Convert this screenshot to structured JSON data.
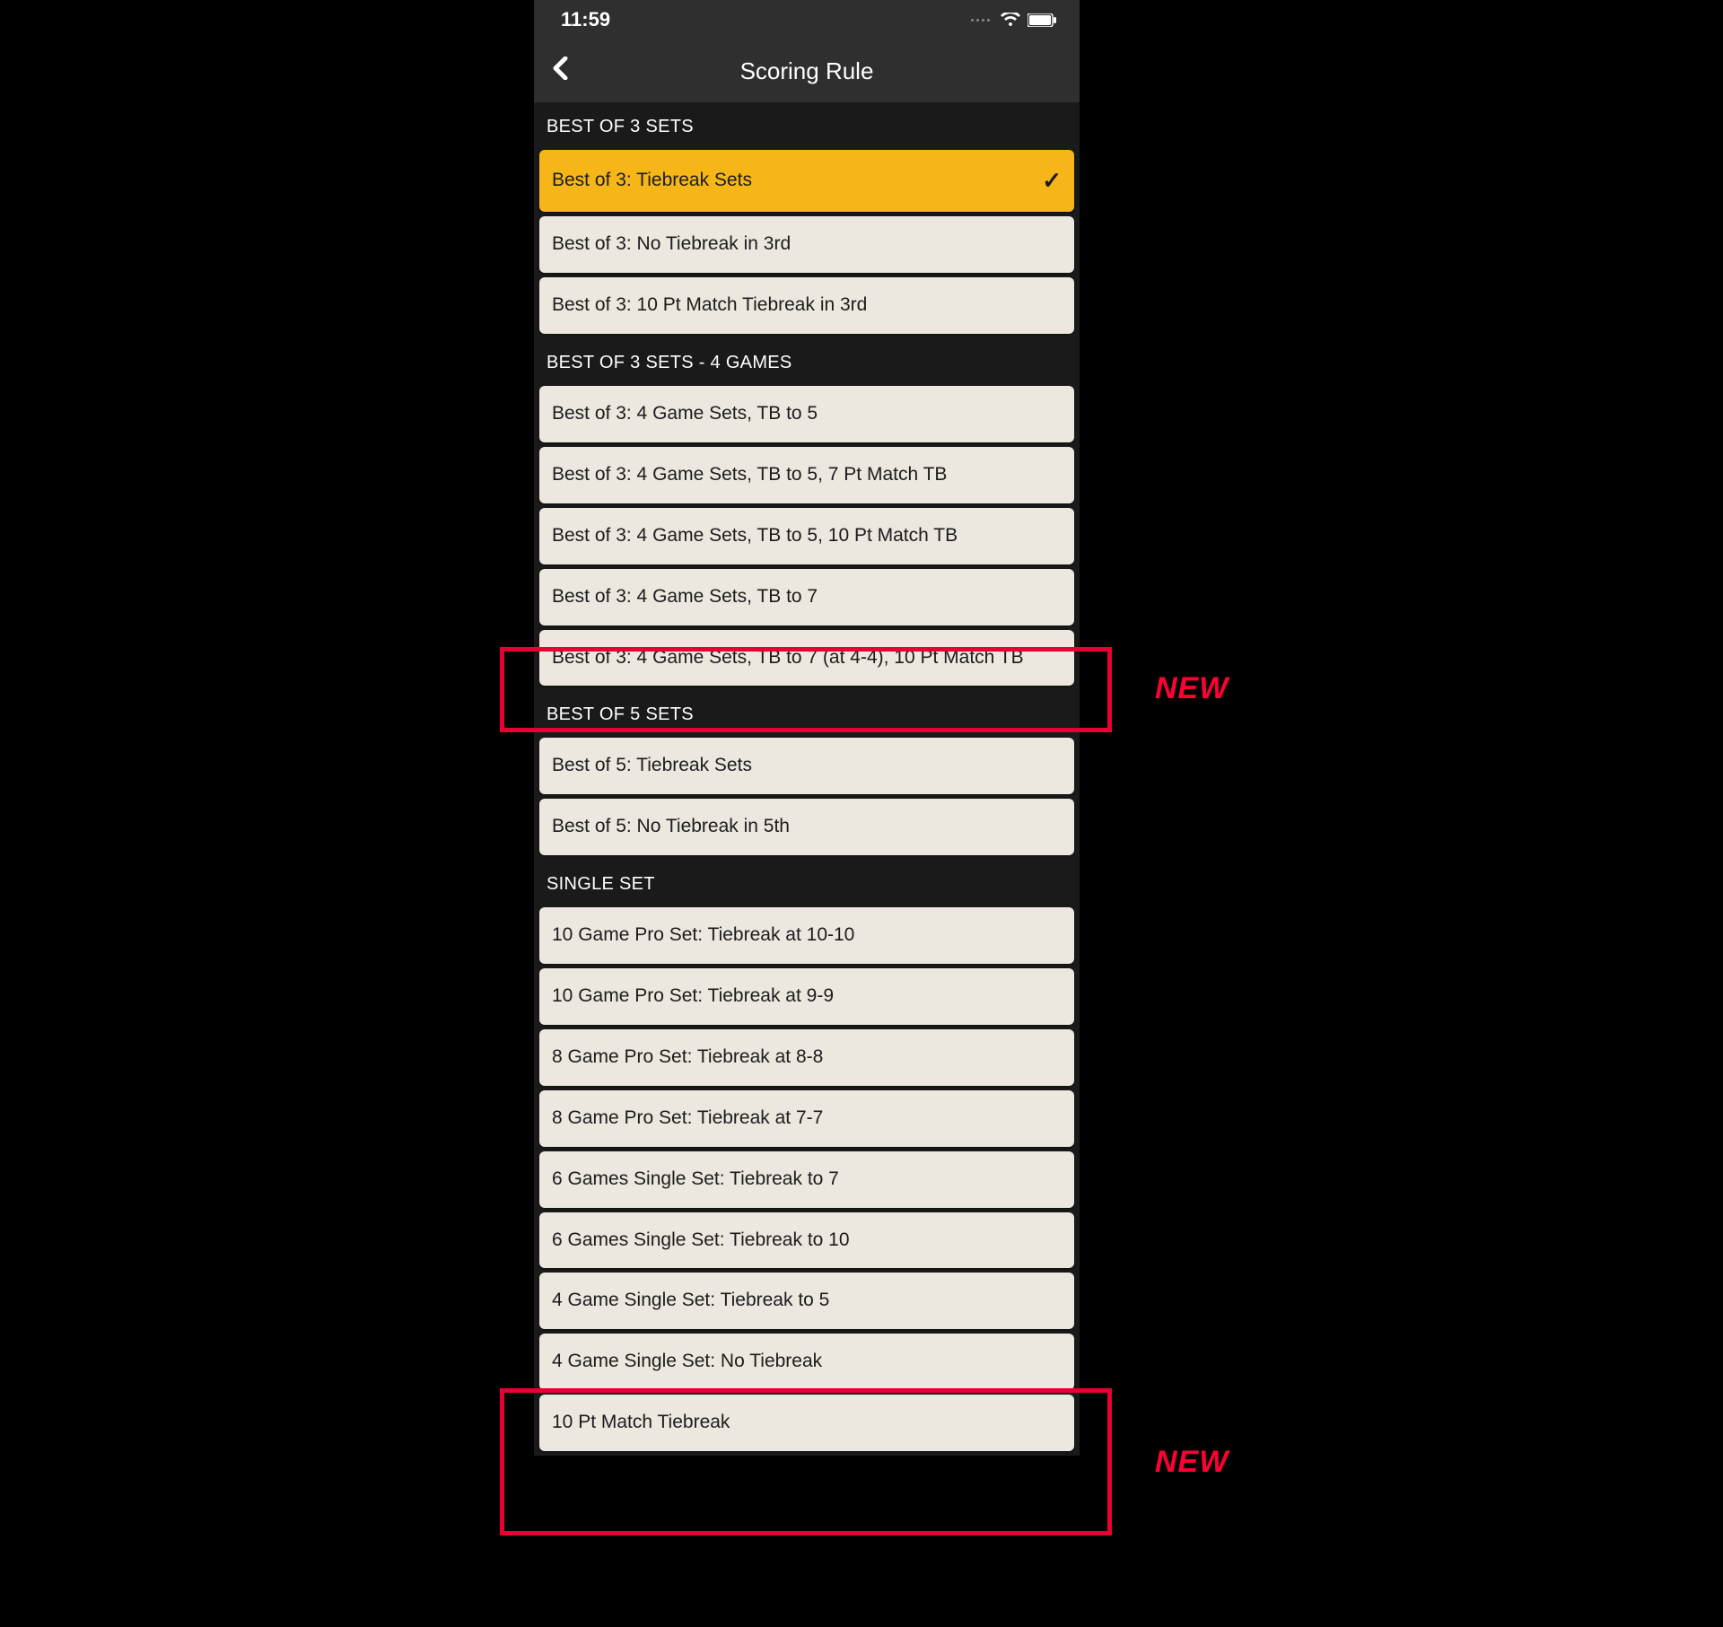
{
  "status": {
    "time": "11:59"
  },
  "nav": {
    "title": "Scoring Rule"
  },
  "sections": [
    {
      "title": "BEST OF 3 SETS",
      "items": [
        {
          "label": "Best of 3: Tiebreak Sets",
          "selected": true
        },
        {
          "label": "Best of 3: No Tiebreak in 3rd"
        },
        {
          "label": "Best of 3: 10 Pt Match Tiebreak in 3rd"
        }
      ]
    },
    {
      "title": "BEST OF 3 SETS - 4 GAMES",
      "items": [
        {
          "label": "Best of 3: 4 Game Sets, TB to 5"
        },
        {
          "label": "Best of 3: 4 Game Sets, TB to 5, 7 Pt Match TB"
        },
        {
          "label": "Best of 3: 4 Game Sets, TB to 5, 10 Pt Match TB"
        },
        {
          "label": "Best of 3: 4 Game Sets, TB to 7"
        },
        {
          "label": "Best of 3: 4 Game Sets, TB to 7 (at 4-4), 10 Pt Match TB"
        }
      ]
    },
    {
      "title": "BEST OF 5 SETS",
      "items": [
        {
          "label": "Best of 5: Tiebreak Sets"
        },
        {
          "label": "Best of 5: No Tiebreak in 5th"
        }
      ]
    },
    {
      "title": "SINGLE SET",
      "items": [
        {
          "label": "10 Game Pro Set: Tiebreak at 10-10"
        },
        {
          "label": "10 Game Pro Set: Tiebreak at 9-9"
        },
        {
          "label": "8 Game Pro Set: Tiebreak at 8-8"
        },
        {
          "label": "8 Game Pro Set: Tiebreak at 7-7"
        },
        {
          "label": "6 Games Single Set: Tiebreak to 7"
        },
        {
          "label": "6 Games Single Set: Tiebreak to 10"
        },
        {
          "label": "4 Game Single Set: Tiebreak to 5"
        },
        {
          "label": "4 Game Single Set: No Tiebreak"
        },
        {
          "label": "10 Pt Match Tiebreak"
        }
      ]
    }
  ],
  "annotations": {
    "new_label": "NEW"
  }
}
